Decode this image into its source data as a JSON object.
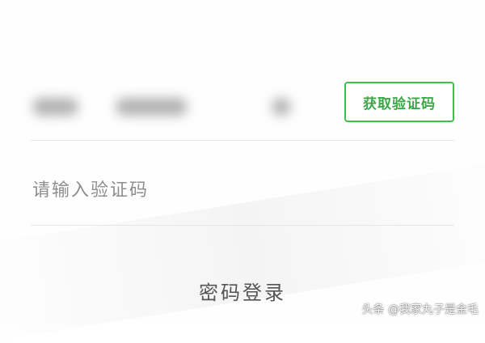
{
  "login": {
    "get_code_label": "获取验证码",
    "code_placeholder": "请输入验证码",
    "password_login_label": "密码登录"
  },
  "watermark": "头条 @我家丸子是金毛",
  "colors": {
    "accent_green": "#3fbf4f",
    "divider": "#e6e6e6",
    "placeholder": "#8e8e8e"
  }
}
